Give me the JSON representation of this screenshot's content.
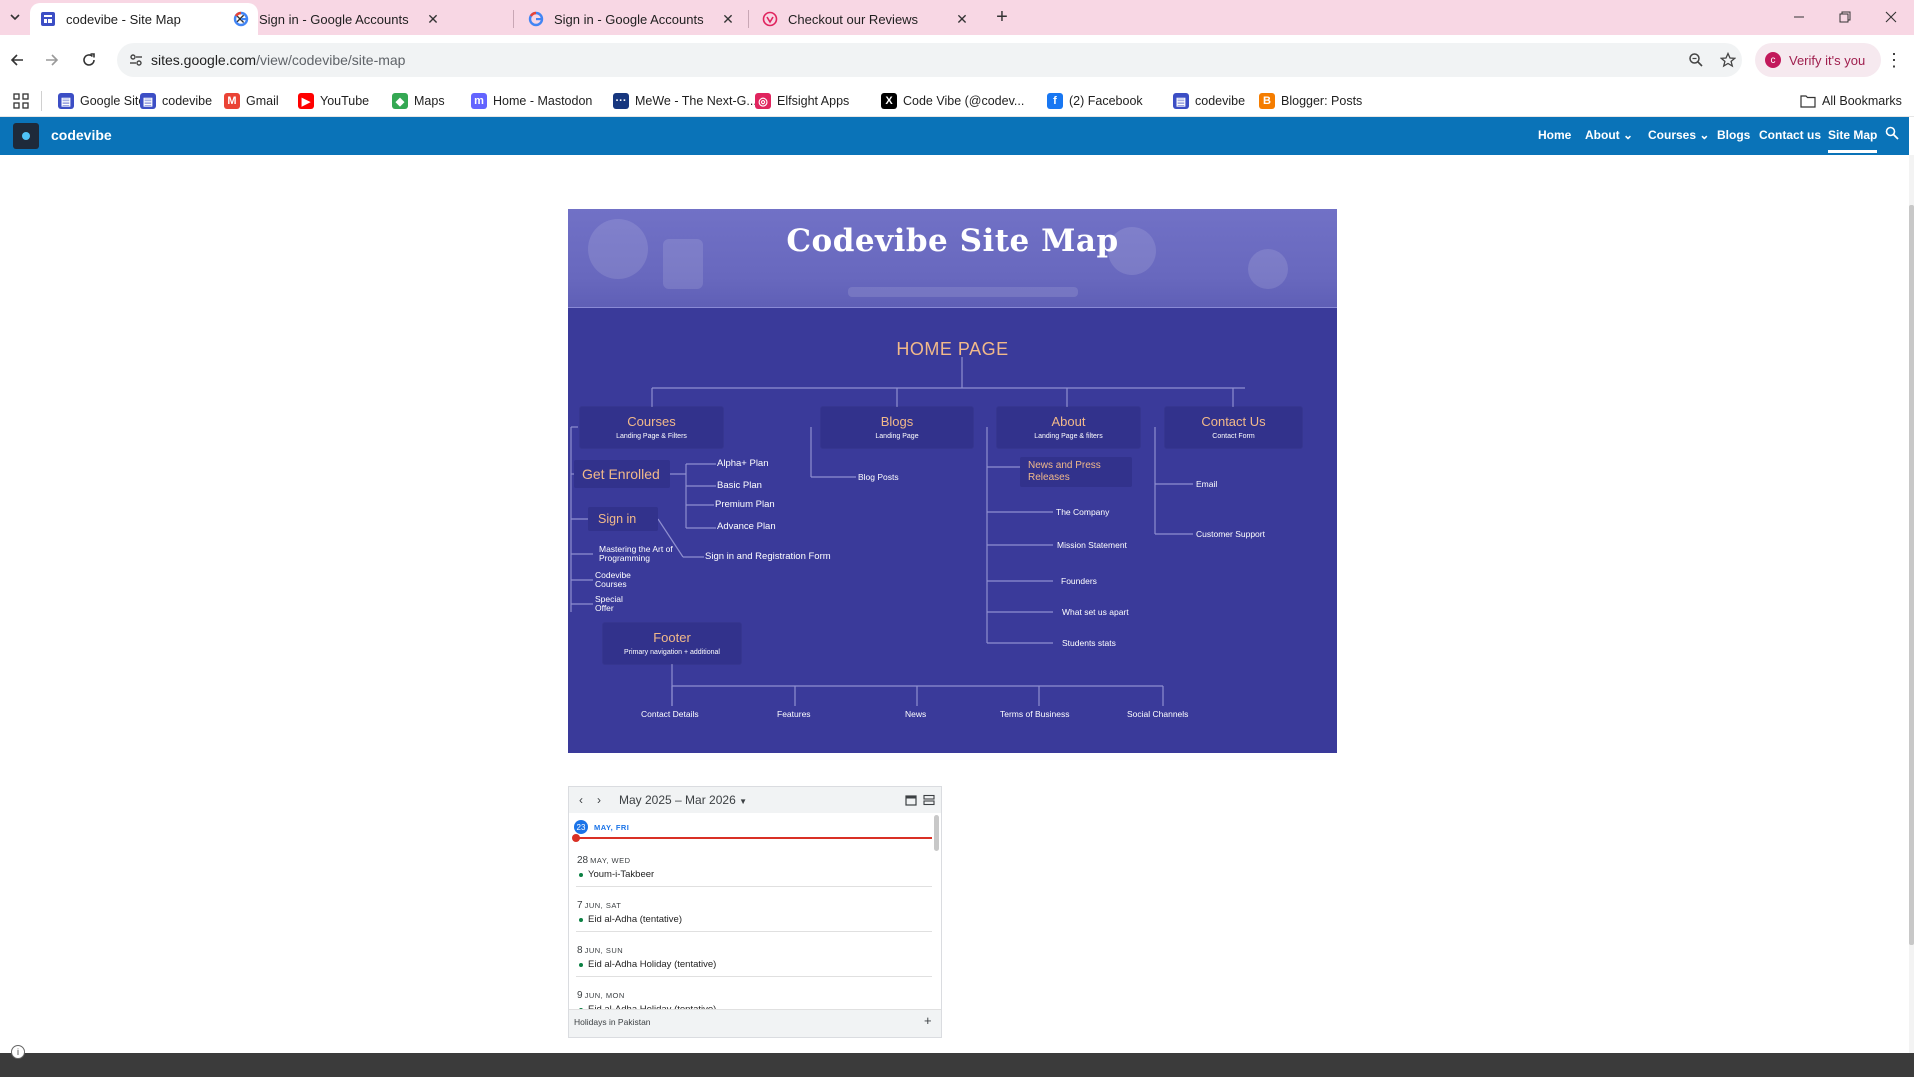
{
  "browser": {
    "tabs": [
      {
        "title": "codevibe - Site Map",
        "active": true,
        "icon": "google-sites-icon"
      },
      {
        "title": "Sign in - Google Accounts",
        "active": false,
        "icon": "google-g-icon"
      },
      {
        "title": "Sign in - Google Accounts",
        "active": false,
        "icon": "google-g-icon"
      },
      {
        "title": "Checkout our Reviews",
        "active": false,
        "icon": "elfsight-icon"
      }
    ],
    "url_host": "sites.google.com",
    "url_path": "/view/codevibe/site-map",
    "verify_label": "Verify it's you",
    "profile_initial": "c",
    "bookmarks": [
      {
        "label": "Google Sites",
        "icon": "google-sites-icon",
        "color": "#3c4ec5"
      },
      {
        "label": "codevibe",
        "icon": "google-sites-icon",
        "color": "#3c4ec5"
      },
      {
        "label": "Gmail",
        "icon": "gmail-icon",
        "color": "#ea4335"
      },
      {
        "label": "YouTube",
        "icon": "youtube-icon",
        "color": "#ff0000"
      },
      {
        "label": "Maps",
        "icon": "maps-icon",
        "color": "#34a853"
      },
      {
        "label": "Home - Mastodon",
        "icon": "mastodon-icon",
        "color": "#6364ff"
      },
      {
        "label": "MeWe - The Next-G...",
        "icon": "mewe-icon",
        "color": "#17377f"
      },
      {
        "label": "Elfsight Apps",
        "icon": "elfsight-icon",
        "color": "#e0245e"
      },
      {
        "label": "Code Vibe (@codev...",
        "icon": "x-icon",
        "color": "#000000"
      },
      {
        "label": "(2) Facebook",
        "icon": "facebook-icon",
        "color": "#1877f2"
      },
      {
        "label": "codevibe",
        "icon": "google-sites-icon",
        "color": "#3c4ec5"
      },
      {
        "label": "Blogger: Posts",
        "icon": "blogger-icon",
        "color": "#f57d00"
      }
    ],
    "all_bookmarks_label": "All Bookmarks"
  },
  "site": {
    "name": "codevibe",
    "nav": [
      {
        "label": "Home",
        "dropdown": false,
        "active": false
      },
      {
        "label": "About",
        "dropdown": true,
        "active": false
      },
      {
        "label": "Courses",
        "dropdown": true,
        "active": false
      },
      {
        "label": "Blogs",
        "dropdown": false,
        "active": false
      },
      {
        "label": "Contact us",
        "dropdown": false,
        "active": false
      },
      {
        "label": "Site Map",
        "dropdown": false,
        "active": true
      }
    ],
    "nav_color": "#0a73b8"
  },
  "sitemap": {
    "title": "Codevibe Site Map",
    "home": "HOME PAGE",
    "sections": {
      "courses": {
        "title": "Courses",
        "sub": "Landing Page & Filters"
      },
      "blogs": {
        "title": "Blogs",
        "sub": "Landing Page"
      },
      "about": {
        "title": "About",
        "sub": "Landing Page & filters"
      },
      "contact": {
        "title": "Contact Us",
        "sub": "Contact Form"
      },
      "footer": {
        "title": "Footer",
        "sub": "Primary navigation + additional"
      }
    },
    "get_enrolled": "Get Enrolled",
    "sign_in": "Sign in",
    "plans": [
      "Alpha+ Plan",
      "Basic Plan",
      "Premium Plan",
      "Advance Plan"
    ],
    "sign_in_form": "Sign in and Registration Form",
    "course_items": [
      "Mastering the Art of Programming",
      "Codevibe Courses",
      "Special Offer"
    ],
    "blog_items": [
      "Blog Posts"
    ],
    "about_highlight": "News and Press Releases",
    "about_items": [
      "The Company",
      "Mission Statement",
      "Founders",
      "What set us apart",
      "Students stats"
    ],
    "contact_items": [
      "Email",
      "Customer Support"
    ],
    "footer_items": [
      "Contact Details",
      "Features",
      "News",
      "Terms of Business",
      "Social Channels"
    ],
    "colors": {
      "background": "#3a3a9a",
      "accent": "#f1b98a",
      "box": "#32328c",
      "line": "#8f8fd0"
    }
  },
  "calendar": {
    "range": "May 2025 – Mar 2026",
    "today": {
      "num": "23",
      "label": "MAY, FRI"
    },
    "events": [
      {
        "num": "28",
        "dow": "MAY, WED",
        "title": "Youm-i-Takbeer"
      },
      {
        "num": "7",
        "dow": "JUN, SAT",
        "title": "Eid al-Adha (tentative)"
      },
      {
        "num": "8",
        "dow": "JUN, SUN",
        "title": "Eid al-Adha Holiday (tentative)"
      },
      {
        "num": "9",
        "dow": "JUN, MON",
        "title": "Eid al-Adha Holiday (tentative)"
      }
    ],
    "footer": "Holidays in Pakistan"
  }
}
